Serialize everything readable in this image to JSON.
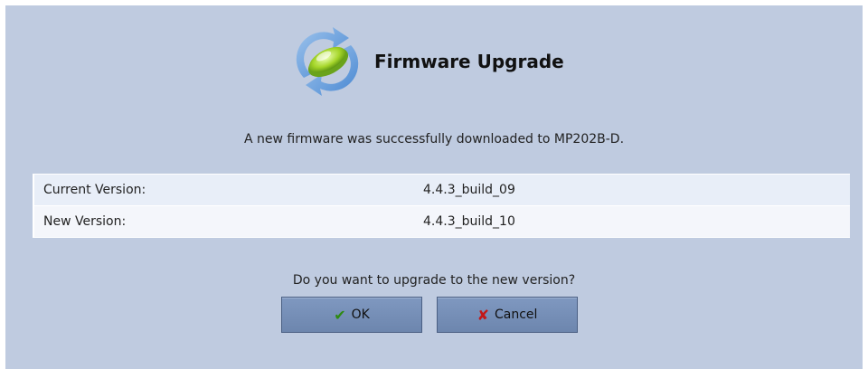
{
  "dialog": {
    "title": "Firmware Upgrade",
    "icon": "firmware-upgrade-icon",
    "message": "A new firmware was successfully downloaded to MP202B-D.",
    "question": "Do you want to upgrade to the new version?"
  },
  "versions": [
    {
      "label": "Current Version:",
      "value": "4.4.3_build_09"
    },
    {
      "label": "New Version:",
      "value": "4.4.3_build_10"
    }
  ],
  "buttons": {
    "ok_label": "OK",
    "ok_icon": "checkmark-icon",
    "cancel_label": "Cancel",
    "cancel_icon": "x-icon"
  },
  "colors": {
    "panel_background": "#bfcbe0",
    "button_background": "#7389b3"
  }
}
